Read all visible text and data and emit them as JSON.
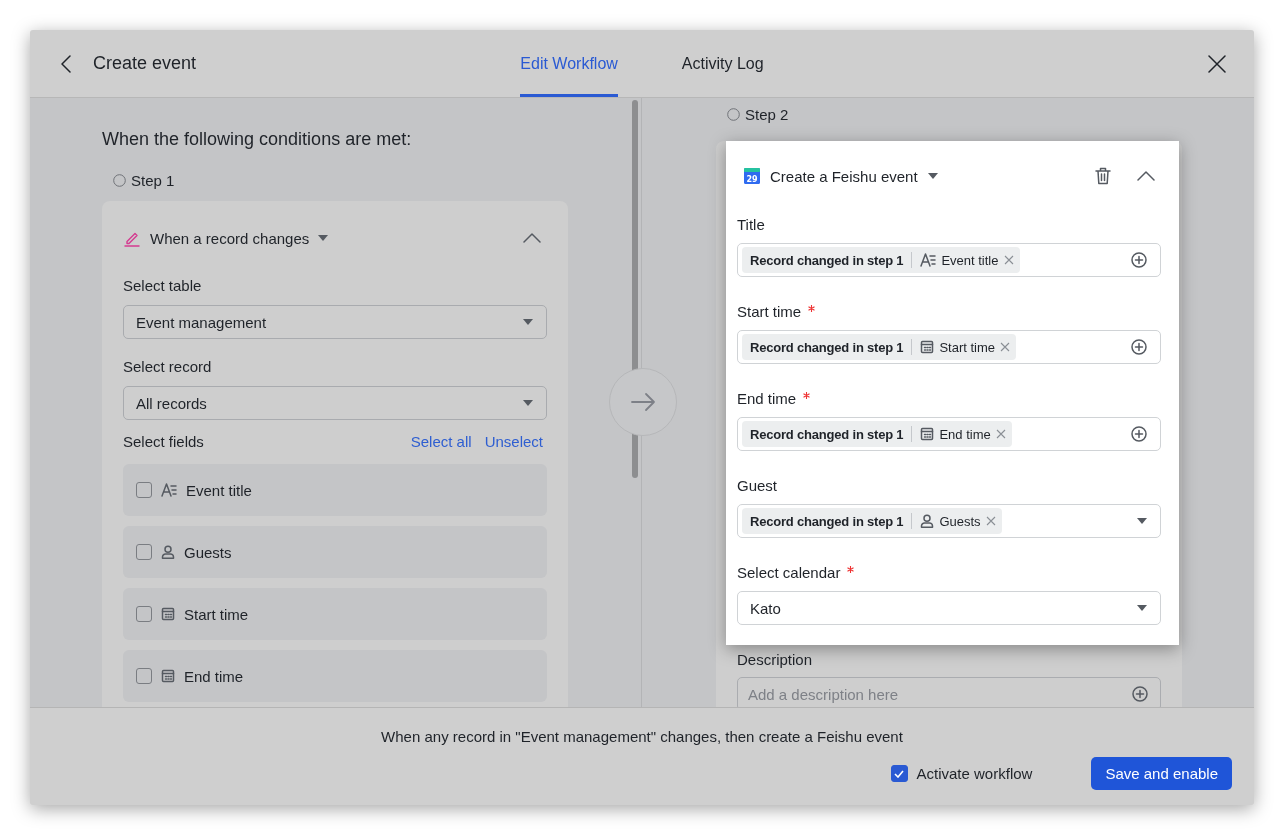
{
  "header": {
    "title": "Create event",
    "tabs": [
      {
        "label": "Edit Workflow",
        "selected": true
      },
      {
        "label": "Activity Log",
        "selected": false
      }
    ]
  },
  "trigger": {
    "heading": "When the following conditions are met:",
    "step": "Step 1",
    "title": "When a record changes",
    "expanded": true,
    "selects": [
      {
        "label": "Select table",
        "value": "Event management"
      },
      {
        "label": "Select record",
        "value": "All records"
      }
    ],
    "fields_label": "Select fields",
    "actions": [
      "Select all",
      "Unselect"
    ],
    "options": [
      {
        "label": "Event title",
        "kind": "text",
        "checked": false
      },
      {
        "label": "Guests",
        "kind": "person",
        "checked": false
      },
      {
        "label": "Start time",
        "kind": "date",
        "checked": false
      },
      {
        "label": "End time",
        "kind": "date",
        "checked": false
      }
    ]
  },
  "action": {
    "step": "Step 2",
    "app_icon_label": "29",
    "title": "Create a Feishu event",
    "expanded": true,
    "fields": [
      {
        "kind": "tokens",
        "label": "Title",
        "required": false,
        "tokens": [
          {
            "source": "Record changed in step 1",
            "field": "Event title",
            "kind": "text"
          }
        ]
      },
      {
        "kind": "tokens",
        "label": "Start time",
        "required": true,
        "tokens": [
          {
            "source": "Record changed in step 1",
            "field": "Start time",
            "kind": "date"
          }
        ]
      },
      {
        "kind": "tokens",
        "label": "End time",
        "required": true,
        "tokens": [
          {
            "source": "Record changed in step 1",
            "field": "End time",
            "kind": "date"
          }
        ]
      },
      {
        "kind": "token_select",
        "label": "Guest",
        "required": false,
        "tokens": [
          {
            "source": "Record changed in step 1",
            "field": "Guests",
            "kind": "person"
          }
        ]
      },
      {
        "kind": "select",
        "label": "Select calendar",
        "required": true,
        "value": "Kato"
      }
    ],
    "description": {
      "label": "Description",
      "placeholder": "Add a description here"
    }
  },
  "footer": {
    "summary": "When any record in \"Event management\" changes, then create a Feishu event",
    "activate": {
      "label": "Activate workflow",
      "checked": true
    },
    "button": "Save and enable"
  }
}
